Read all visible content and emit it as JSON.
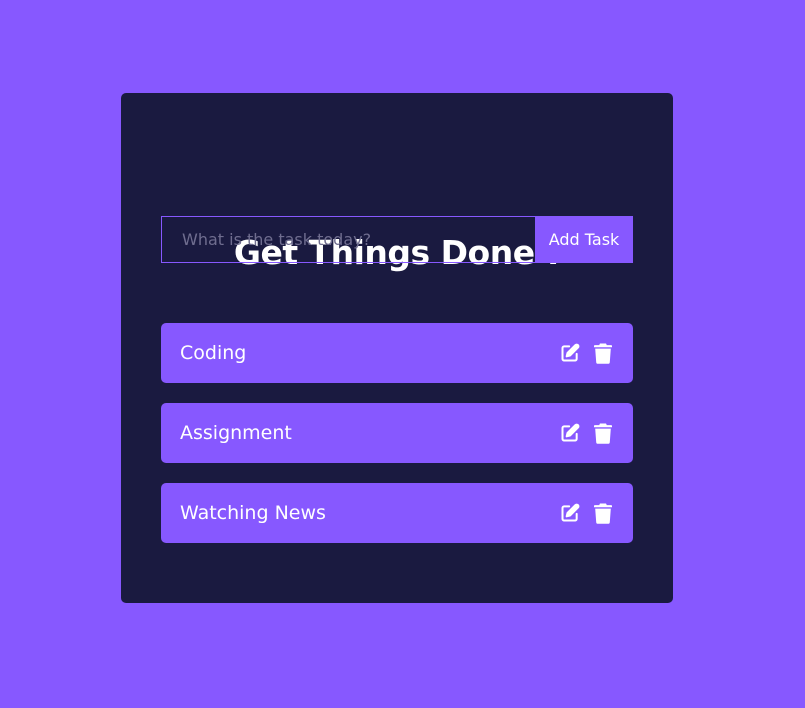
{
  "app": {
    "title": "Get Things Done !"
  },
  "form": {
    "placeholder": "What is the task today?",
    "value": "",
    "button_label": "Add Task"
  },
  "todos": [
    {
      "label": "Coding",
      "edit_icon": "edit-icon",
      "delete_icon": "trash-icon"
    },
    {
      "label": "Assignment",
      "edit_icon": "edit-icon",
      "delete_icon": "trash-icon"
    },
    {
      "label": "Watching News",
      "edit_icon": "edit-icon",
      "delete_icon": "trash-icon"
    }
  ],
  "colors": {
    "background": "#8758ff",
    "card": "#1a1a40",
    "accent": "#8758ff",
    "text": "#ffffff"
  }
}
